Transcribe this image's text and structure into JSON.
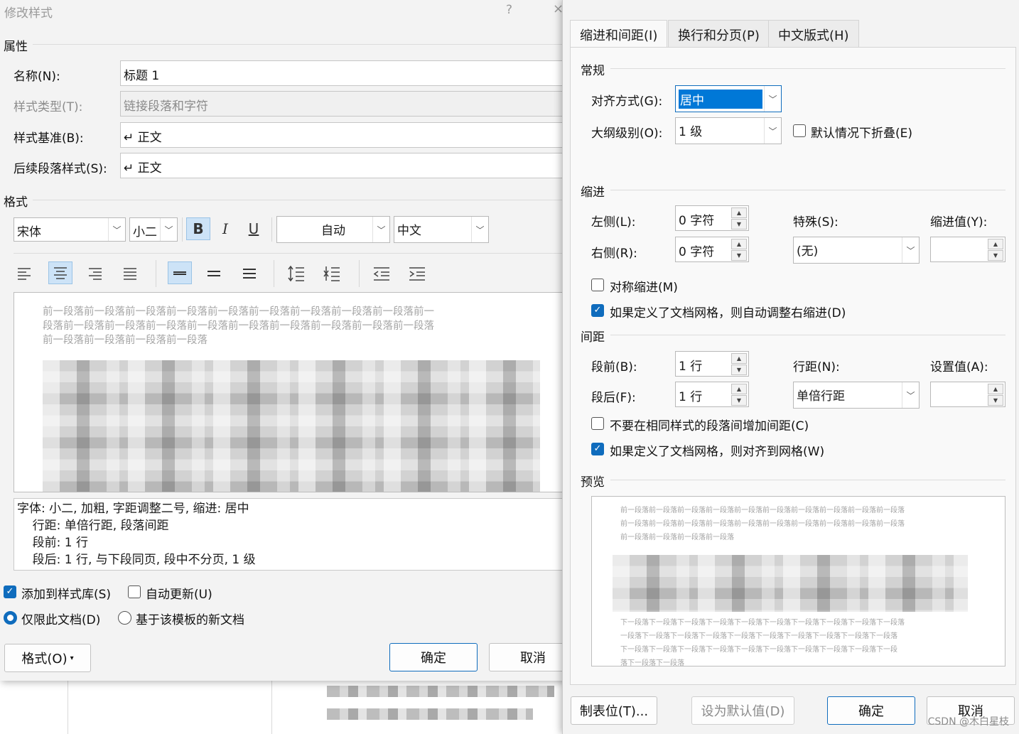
{
  "left_dialog": {
    "title": "修改样式",
    "help": "?",
    "close": "×",
    "properties_header": "属性",
    "name_label": "名称(N):",
    "name_value": "标题 1",
    "style_type_label": "样式类型(T):",
    "style_type_value": "链接段落和字符",
    "based_on_label": "样式基准(B):",
    "based_on_value": "↵ 正文",
    "next_style_label": "后续段落样式(S):",
    "next_style_value": "↵ 正文",
    "format_header": "格式",
    "font": "宋体",
    "size": "小二",
    "bold": "B",
    "italic": "I",
    "underline": "U",
    "color": "自动",
    "script": "中文",
    "preview_prev_lines": [
      "前一段落前一段落前一段落前一段落前一段落前一段落前一段落前一段落前一段落前一",
      "段落前一段落前一段落前一段落前一段落前一段落前一段落前一段落前一段落前一段落",
      "前一段落前一段落前一段落前一段落"
    ],
    "description_lines": [
      "字体: 小二, 加粗, 字距调整二号, 缩进: 居中",
      "    行距: 单倍行距, 段落间距",
      "    段前: 1 行",
      "    段后: 1 行, 与下段同页, 段中不分页, 1 级"
    ],
    "add_to_gallery": "添加到样式库(S)",
    "auto_update": "自动更新(U)",
    "only_this_doc": "仅限此文档(D)",
    "new_docs_template": "基于该模板的新文档",
    "format_button": "格式(O)",
    "ok_button": "确定",
    "cancel_button": "取消"
  },
  "right_dialog": {
    "tabs": [
      "缩进和间距(I)",
      "换行和分页(P)",
      "中文版式(H)"
    ],
    "general_header": "常规",
    "alignment_label": "对齐方式(G):",
    "alignment_value": "居中",
    "outline_label": "大纲级别(O):",
    "outline_value": "1 级",
    "collapse_label": "默认情况下折叠(E)",
    "indent_header": "缩进",
    "left_label": "左侧(L):",
    "left_value": "0 字符",
    "right_label": "右侧(R):",
    "right_value": "0 字符",
    "special_label": "特殊(S):",
    "special_value": "(无)",
    "indent_by_label": "缩进值(Y):",
    "mirror_indent": "对称缩进(M)",
    "auto_adjust_right": "如果定义了文档网格，则自动调整右缩进(D)",
    "spacing_header": "间距",
    "before_label": "段前(B):",
    "before_value": "1 行",
    "after_label": "段后(F):",
    "after_value": "1 行",
    "line_spacing_label": "行距(N):",
    "line_spacing_value": "单倍行距",
    "at_label": "设置值(A):",
    "dont_add_space": "不要在相同样式的段落间增加间距(C)",
    "snap_to_grid": "如果定义了文档网格，则对齐到网格(W)",
    "preview_header": "预览",
    "preview_prev_lines": [
      "前一段落前一段落前一段落前一段落前一段落前一段落前一段落前一段落前一段落前一段落",
      "前一段落前一段落前一段落前一段落前一段落前一段落前一段落前一段落前一段落前一段落",
      "前一段落前一段落前一段落前一段落"
    ],
    "preview_next_lines": [
      "下一段落下一段落下一段落下一段落下一段落下一段落下一段落下一段落下一段落下一段落",
      "一段落下一段落下一段落下一段落下一段落下一段落下一段落下一段落下一段落下一段落",
      "下一段落下一段落下一段落下一段落下一段落下一段落下一段落下一段落下一段落下一段",
      "落下一段落下一段落"
    ],
    "tabs_button": "制表位(T)...",
    "default_button": "设为默认值(D)",
    "ok_button": "确定",
    "cancel_button": "取消",
    "watermark": "CSDN @木白星枝"
  },
  "colors": {
    "accent": "#0f6cbd",
    "selection": "#0078d7"
  }
}
